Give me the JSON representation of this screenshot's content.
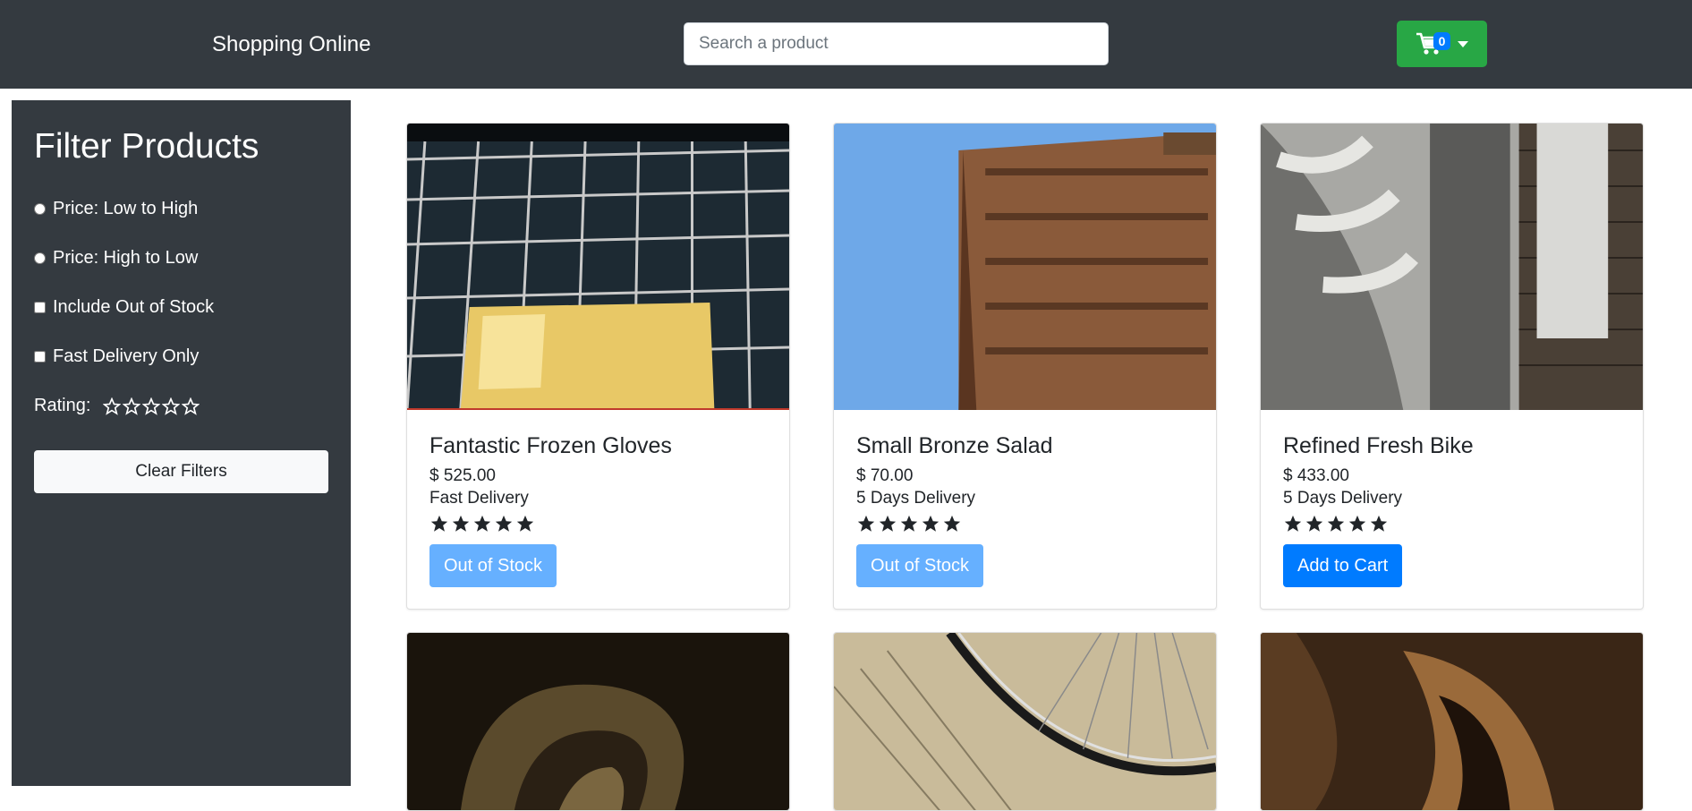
{
  "header": {
    "brand": "Shopping Online",
    "search_placeholder": "Search a product",
    "cart_count": "0",
    "cart_color": "#28a745",
    "badge_color": "#007bff"
  },
  "sidebar": {
    "title": "Filter Products",
    "sort_low_high": "Price: Low to High",
    "sort_high_low": "Price: High to Low",
    "include_out_of_stock": "Include Out of Stock",
    "fast_delivery_only": "Fast Delivery Only",
    "rating_label": "Rating:",
    "rating_stars": 0,
    "clear_label": "Clear Filters"
  },
  "products": [
    {
      "name": "Fantastic Frozen Gloves",
      "price": "$ 525.00",
      "delivery": "Fast Delivery",
      "rating": 5,
      "button": "Out of Stock",
      "in_stock": false
    },
    {
      "name": "Small Bronze Salad",
      "price": "$ 70.00",
      "delivery": "5 Days Delivery",
      "rating": 5,
      "button": "Out of Stock",
      "in_stock": false
    },
    {
      "name": "Refined Fresh Bike",
      "price": "$ 433.00",
      "delivery": "5 Days Delivery",
      "rating": 5,
      "button": "Add to Cart",
      "in_stock": true
    }
  ],
  "icons": {
    "cart": "cart-icon",
    "caret": "caret-down-icon",
    "star_filled": "star-filled-icon",
    "star_empty": "star-outline-icon"
  }
}
